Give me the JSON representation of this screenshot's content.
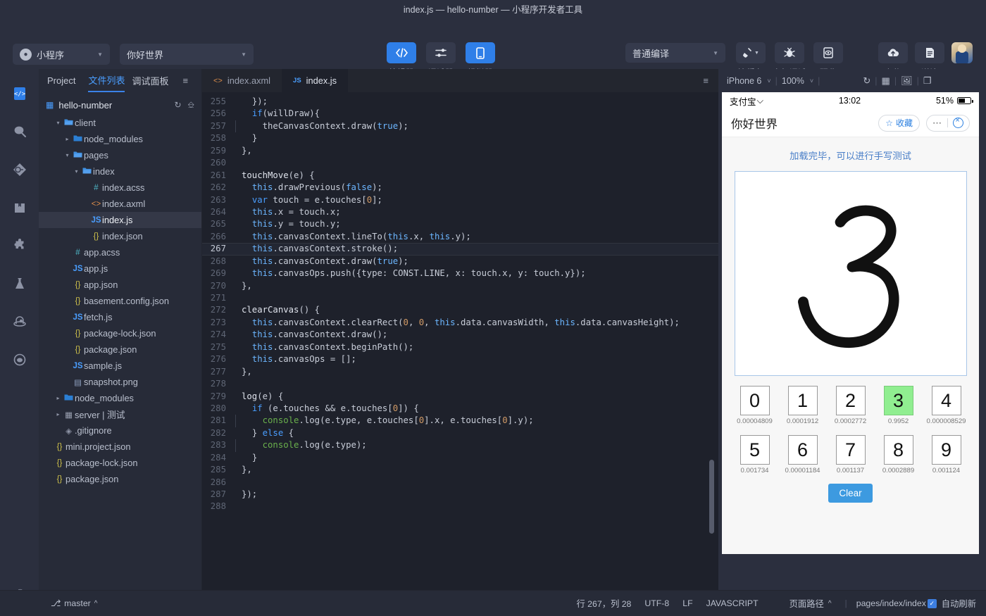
{
  "window": {
    "title": "index.js — hello-number — 小程序开发者工具"
  },
  "toolbar": {
    "account_select": {
      "label": "小程序",
      "icon": "alipay-logo-icon"
    },
    "project_select": {
      "label": "你好世界"
    },
    "center_buttons": [
      {
        "label": "编辑器",
        "icon": "code-icon",
        "active": true
      },
      {
        "label": "调试器",
        "icon": "sliders-icon",
        "active": false
      },
      {
        "label": "模拟器",
        "icon": "phone-icon",
        "active": true
      }
    ],
    "compile_select": {
      "label": "普通编译"
    },
    "action_buttons": [
      {
        "label": "清缓存",
        "icon": "broom-icon"
      },
      {
        "label": "真机调试",
        "icon": "bug-icon"
      },
      {
        "label": "预览",
        "icon": "preview-icon"
      }
    ],
    "right_buttons": [
      {
        "label": "上传",
        "icon": "cloud-upload-icon"
      },
      {
        "label": "详情",
        "icon": "document-icon"
      }
    ],
    "avatar": {
      "name": "user-avatar"
    }
  },
  "activitybar": {
    "items": [
      {
        "icon": "code-file-icon",
        "selected": true
      },
      {
        "icon": "search-icon",
        "selected": false
      },
      {
        "icon": "source-control-icon",
        "selected": false
      },
      {
        "icon": "package-icon",
        "selected": false
      },
      {
        "icon": "puzzle-extension-icon",
        "selected": false
      },
      {
        "icon": "flask-experiment-icon",
        "selected": false
      },
      {
        "icon": "cloud-storage-icon",
        "selected": false
      },
      {
        "icon": "help-support-icon",
        "selected": false
      }
    ],
    "settings": {
      "icon": "gear-icon"
    }
  },
  "sidebar": {
    "tabs": [
      {
        "label": "Project",
        "active": false,
        "plain": true
      },
      {
        "label": "文件列表",
        "active": true
      },
      {
        "label": "调试面板",
        "active": false
      }
    ],
    "collapse_icon": "collapse-list-icon",
    "project": {
      "name": "hello-number",
      "icon": "grid-icon",
      "refresh_icon": "refresh-icon",
      "collapse_icon": "collapse-all-icon"
    },
    "tree": [
      {
        "label": "client",
        "depth": 1,
        "arrow": "▾",
        "icon": "folder-open",
        "itype": "i-folder"
      },
      {
        "label": "node_modules",
        "depth": 2,
        "arrow": "▸",
        "icon": "folder",
        "itype": "i-folder"
      },
      {
        "label": "pages",
        "depth": 2,
        "arrow": "▾",
        "icon": "folder-open",
        "itype": "i-folder"
      },
      {
        "label": "index",
        "depth": 3,
        "arrow": "▾",
        "icon": "folder-open",
        "itype": "i-folder"
      },
      {
        "label": "index.acss",
        "depth": 4,
        "arrow": "",
        "icon": "#",
        "itype": "i-hash"
      },
      {
        "label": "index.axml",
        "depth": 4,
        "arrow": "",
        "icon": "<>",
        "itype": "i-xml"
      },
      {
        "label": "index.js",
        "depth": 4,
        "arrow": "",
        "icon": "JS",
        "itype": "i-js",
        "selected": true
      },
      {
        "label": "index.json",
        "depth": 4,
        "arrow": "",
        "icon": "{}",
        "itype": "i-json"
      },
      {
        "label": "app.acss",
        "depth": 2,
        "arrow": "",
        "icon": "#",
        "itype": "i-hash"
      },
      {
        "label": "app.js",
        "depth": 2,
        "arrow": "",
        "icon": "JS",
        "itype": "i-js"
      },
      {
        "label": "app.json",
        "depth": 2,
        "arrow": "",
        "icon": "{}",
        "itype": "i-json"
      },
      {
        "label": "basement.config.json",
        "depth": 2,
        "arrow": "",
        "icon": "{}",
        "itype": "i-json"
      },
      {
        "label": "fetch.js",
        "depth": 2,
        "arrow": "",
        "icon": "JS",
        "itype": "i-js"
      },
      {
        "label": "package-lock.json",
        "depth": 2,
        "arrow": "",
        "icon": "{}",
        "itype": "i-json"
      },
      {
        "label": "package.json",
        "depth": 2,
        "arrow": "",
        "icon": "{}",
        "itype": "i-json"
      },
      {
        "label": "sample.js",
        "depth": 2,
        "arrow": "",
        "icon": "JS",
        "itype": "i-js"
      },
      {
        "label": "snapshot.png",
        "depth": 2,
        "arrow": "",
        "icon": "▤",
        "itype": "i-img"
      },
      {
        "label": "node_modules",
        "depth": 1,
        "arrow": "▸",
        "icon": "folder",
        "itype": "i-folder"
      },
      {
        "label": "server | 测试",
        "depth": 1,
        "arrow": "▸",
        "icon": "▦",
        "itype": "i-grid"
      },
      {
        "label": ".gitignore",
        "depth": 1,
        "arrow": "",
        "icon": "◈",
        "itype": "i-git"
      },
      {
        "label": "mini.project.json",
        "depth": 0,
        "arrow": "",
        "icon": "{}",
        "itype": "i-json"
      },
      {
        "label": "package-lock.json",
        "depth": 0,
        "arrow": "",
        "icon": "{}",
        "itype": "i-json"
      },
      {
        "label": "package.json",
        "depth": 0,
        "arrow": "",
        "icon": "{}",
        "itype": "i-json"
      }
    ]
  },
  "editor": {
    "tabs": [
      {
        "label": "index.axml",
        "icon": "<>",
        "itype": "i-xml",
        "active": false
      },
      {
        "label": "index.js",
        "icon": "JS",
        "itype": "i-js",
        "active": true
      }
    ],
    "toolbar_icon": "editor-layout-icon",
    "highlight_line": 267,
    "first_line": 255,
    "lines": [
      {
        "n": 255,
        "html": "  <span class='cons'>});</span>"
      },
      {
        "n": 256,
        "html": "  <span class='kw2'>if</span><span class='cons'>(willDraw){</span>"
      },
      {
        "n": 257,
        "html": "    <span class='gut'></span><span class='cons'>theCanvasContext.draw(</span><span class='prop'>true</span><span class='cons'>);</span>"
      },
      {
        "n": 258,
        "html": "  <span class='cons'>}</span>"
      },
      {
        "n": 259,
        "html": "<span class='cons'>},</span>"
      },
      {
        "n": 260,
        "html": ""
      },
      {
        "n": 261,
        "html": "<span class='fn'>touchMove</span><span class='cons'>(e) {</span>"
      },
      {
        "n": 262,
        "html": "  <span class='prop'>this</span><span class='cons'>.drawPrevious(</span><span class='prop'>false</span><span class='cons'>);</span>"
      },
      {
        "n": 263,
        "html": "  <span class='kw2'>var</span><span class='cons'> touch = e.touches[</span><span class='num'>0</span><span class='cons'>];</span>"
      },
      {
        "n": 264,
        "html": "  <span class='prop'>this</span><span class='cons'>.x = touch.x;</span>"
      },
      {
        "n": 265,
        "html": "  <span class='prop'>this</span><span class='cons'>.y = touch.y;</span>"
      },
      {
        "n": 266,
        "html": "  <span class='prop'>this</span><span class='cons'>.canvasContext.lineTo(</span><span class='prop'>this</span><span class='cons'>.x, </span><span class='prop'>this</span><span class='cons'>.y);</span>"
      },
      {
        "n": 267,
        "html": "  <span class='prop'>this</span><span class='cons'>.canvasContext.stroke();</span>"
      },
      {
        "n": 268,
        "html": "  <span class='prop'>this</span><span class='cons'>.canvasContext.draw(</span><span class='prop'>true</span><span class='cons'>);</span>"
      },
      {
        "n": 269,
        "html": "  <span class='prop'>this</span><span class='cons'>.canvasOps.push({type: CONST.LINE, x: touch.x, y: touch.y});</span>"
      },
      {
        "n": 270,
        "html": "<span class='cons'>},</span>"
      },
      {
        "n": 271,
        "html": ""
      },
      {
        "n": 272,
        "html": "<span class='fn'>clearCanvas</span><span class='cons'>() {</span>"
      },
      {
        "n": 273,
        "html": "  <span class='prop'>this</span><span class='cons'>.canvasContext.clearRect(</span><span class='num'>0</span><span class='cons'>, </span><span class='num'>0</span><span class='cons'>, </span><span class='prop'>this</span><span class='cons'>.data.canvasWidth, </span><span class='prop'>this</span><span class='cons'>.data.canvasHeight);</span>"
      },
      {
        "n": 274,
        "html": "  <span class='prop'>this</span><span class='cons'>.canvasContext.draw();</span>"
      },
      {
        "n": 275,
        "html": "  <span class='prop'>this</span><span class='cons'>.canvasContext.beginPath();</span>"
      },
      {
        "n": 276,
        "html": "  <span class='prop'>this</span><span class='cons'>.canvasOps = [];</span>"
      },
      {
        "n": 277,
        "html": "<span class='cons'>},</span>"
      },
      {
        "n": 278,
        "html": ""
      },
      {
        "n": 279,
        "html": "<span class='fn'>log</span><span class='cons'>(e) {</span>"
      },
      {
        "n": 280,
        "html": "  <span class='kw2'>if</span><span class='cons'> (e.touches &amp;&amp; e.touches[</span><span class='num'>0</span><span class='cons'>]) {</span>"
      },
      {
        "n": 281,
        "html": "    <span class='gut'></span><span class='grn'>console</span><span class='cons'>.log(e.type, e.touches[</span><span class='num'>0</span><span class='cons'>].x, e.touches[</span><span class='num'>0</span><span class='cons'>].y);</span>"
      },
      {
        "n": 282,
        "html": "  <span class='cons'>} </span><span class='kw2'>else</span><span class='cons'> {</span>"
      },
      {
        "n": 283,
        "html": "    <span class='gut'></span><span class='grn'>console</span><span class='cons'>.log(e.type);</span>"
      },
      {
        "n": 284,
        "html": "  <span class='cons'>}</span>"
      },
      {
        "n": 285,
        "html": "<span class='cons'>},</span>"
      },
      {
        "n": 286,
        "html": ""
      },
      {
        "n": 287,
        "html": "<span class='cons'>});</span>"
      },
      {
        "n": 288,
        "html": ""
      }
    ]
  },
  "simulator": {
    "device": "iPhone 6",
    "zoom": "100%",
    "icons": [
      "refresh-icon",
      "grid-apps-icon",
      "screenshot-timer-icon",
      "multi-window-icon"
    ],
    "phone": {
      "status": {
        "carrier": "支付宝",
        "wifi_icon": "wifi-icon",
        "time": "13:02",
        "battery": "51%"
      },
      "nav": {
        "title": "你好世界",
        "favorite_label": "收藏",
        "favorite_icon": "star-icon",
        "more_icon": "more-dots-icon",
        "close_icon": "close-circle-icon"
      },
      "hint": "加载完毕，可以进行手写测试",
      "canvas": {
        "drawn_digit": "3"
      },
      "clear_button": "Clear",
      "predictions": [
        {
          "digit": "0",
          "prob": "0.00004809",
          "selected": false
        },
        {
          "digit": "1",
          "prob": "0.0001912",
          "selected": false
        },
        {
          "digit": "2",
          "prob": "0.0002772",
          "selected": false
        },
        {
          "digit": "3",
          "prob": "0.9952",
          "selected": true
        },
        {
          "digit": "4",
          "prob": "0.000008529",
          "selected": false
        },
        {
          "digit": "5",
          "prob": "0.001734",
          "selected": false
        },
        {
          "digit": "6",
          "prob": "0.00001184",
          "selected": false
        },
        {
          "digit": "7",
          "prob": "0.001137",
          "selected": false
        },
        {
          "digit": "8",
          "prob": "0.0002889",
          "selected": false
        },
        {
          "digit": "9",
          "prob": "0.001124",
          "selected": false
        }
      ]
    }
  },
  "statusbar": {
    "branch": "master",
    "branch_icon": "git-branch-icon",
    "cursor": "行 267，列 28",
    "encoding": "UTF-8",
    "eol": "LF",
    "language": "JAVASCRIPT",
    "page_path_label": "页面路径",
    "page_path": "pages/index/index",
    "auto_refresh": "自动刷新"
  },
  "colors": {
    "accent_blue": "#3d9ae0",
    "toolbar_active": "#2f7fe8",
    "selection_green": "#90ee90",
    "bg_dark": "#2b2f3e",
    "editor_bg": "#1e212b"
  }
}
